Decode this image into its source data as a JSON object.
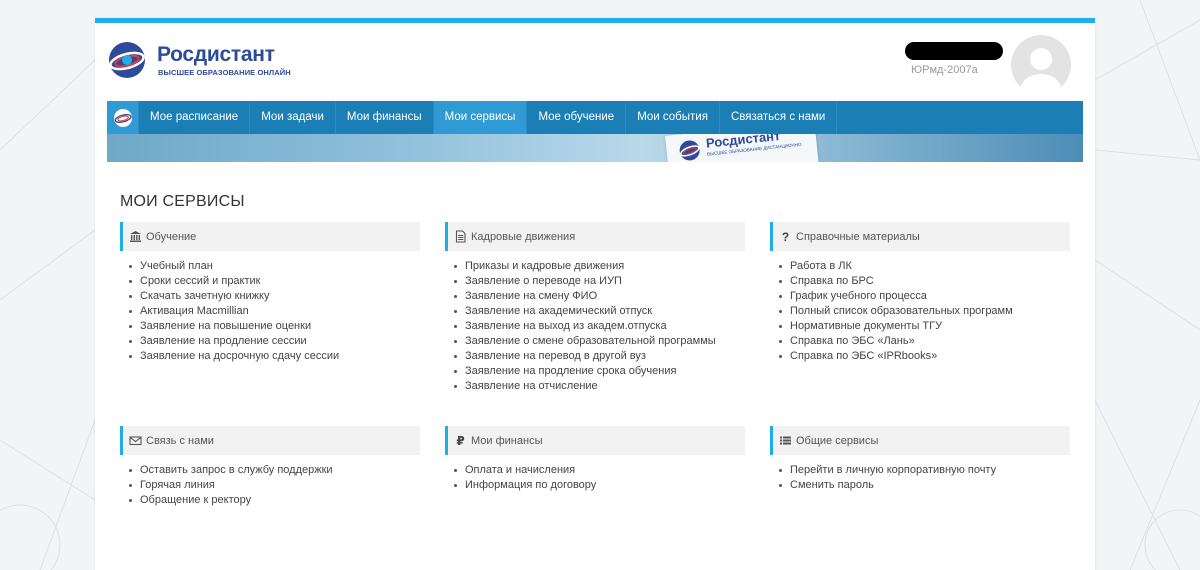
{
  "brand": {
    "name": "Росдистант",
    "tagline": "ВЫСШЕЕ ОБРАЗОВАНИЕ ОНЛАЙН",
    "colors": {
      "brand": "#2e4a98",
      "accent": "#1eaeea",
      "nav": "#1b7fb6",
      "nav_active": "#2f9ad3"
    }
  },
  "user": {
    "group": "ЮРмд-2007а",
    "avatar_icon": "user-avatar-icon"
  },
  "nav": {
    "home_icon": "home-logo-icon",
    "items": [
      {
        "label": "Мое расписание"
      },
      {
        "label": "Мои задачи"
      },
      {
        "label": "Мои финансы"
      },
      {
        "label": "Мои сервисы",
        "active": true
      },
      {
        "label": "Мое обучение"
      },
      {
        "label": "Мои события"
      },
      {
        "label": "Связаться с нами"
      }
    ]
  },
  "banner": {
    "name": "Росдистант",
    "tagline": "ВЫСШЕЕ ОБРАЗОВАНИЕ ДИСТАНЦИОННО"
  },
  "page": {
    "title": "МОИ СЕРВИСЫ"
  },
  "blocks": [
    {
      "title": "Обучение",
      "icon": "institution-icon",
      "items": [
        "Учебный план",
        "Сроки сессий и практик",
        "Скачать зачетную книжку",
        "Активация Macmillian",
        "Заявление на повышение оценки",
        "Заявление на продление сессии",
        "Заявление на досрочную сдачу сессии"
      ]
    },
    {
      "title": "Кадровые движения",
      "icon": "document-icon",
      "items": [
        "Приказы и кадровые движения",
        "Заявление о переводе на ИУП",
        "Заявление на смену ФИО",
        "Заявление на академический отпуск",
        "Заявление на выход из академ.отпуска",
        "Заявление о смене образовательной программы",
        "Заявление на перевод в другой вуз",
        "Заявление на продление срока обучения",
        "Заявление на отчисление"
      ]
    },
    {
      "title": "Справочные материалы",
      "icon": "question-icon",
      "items": [
        "Работа в ЛК",
        "Справка по БРС",
        "График учебного процесса",
        "Полный список образовательных программ",
        "Нормативные документы ТГУ",
        "Справка по ЭБС «Лань»",
        "Справка по ЭБС «IPRbooks»"
      ]
    },
    {
      "title": "Связь с нами",
      "icon": "envelope-icon",
      "items": [
        "Оставить запрос в службу поддержки",
        "Горячая линия",
        "Обращение к ректору"
      ]
    },
    {
      "title": "Мои финансы",
      "icon": "ruble-icon",
      "items": [
        "Оплата и начисления",
        "Информация по договору"
      ]
    },
    {
      "title": "Общие сервисы",
      "icon": "list-icon",
      "items": [
        "Перейти в личную корпоративную почту",
        "Сменить пароль"
      ]
    }
  ]
}
